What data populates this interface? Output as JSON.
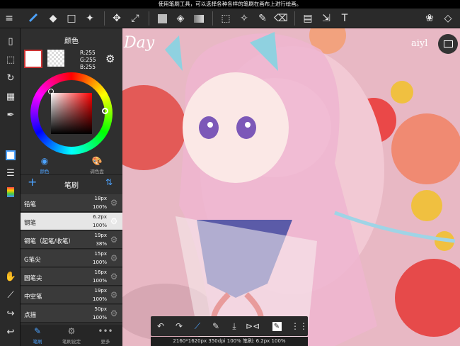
{
  "status": {
    "message": "使用笔刷工具，可以选择各种各样的笔刷在画布上进行绘画。"
  },
  "toolbar": {
    "icons": [
      "menu-icon",
      "brush-tool-icon",
      "eraser-tool-icon",
      "shape-tool-icon",
      "magic-wand-icon",
      "move-icon",
      "transform-icon",
      "fill-color-icon",
      "bucket-icon",
      "gradient-icon",
      "select-rect-icon",
      "auto-select-icon",
      "select-pen-icon",
      "select-eraser-icon",
      "panel-layout-icon",
      "hand-select-icon",
      "text-tool-icon",
      "material-icon",
      "layers-icon"
    ]
  },
  "color_panel": {
    "title": "颜色",
    "r": "R:255",
    "g": "G:255",
    "b": "B:255",
    "tab_color": "颜色",
    "tab_palette": "调色盘"
  },
  "brush_panel": {
    "title": "笔刷",
    "items": [
      {
        "name": "铅笔",
        "size": "18px",
        "opacity": "100%"
      },
      {
        "name": "钢笔",
        "size": "6.2px",
        "opacity": "100%"
      },
      {
        "name": "钢笔（起笔/收笔）",
        "size": "19px",
        "opacity": "38%"
      },
      {
        "name": "G笔尖",
        "size": "15px",
        "opacity": "100%"
      },
      {
        "name": "圆笔尖",
        "size": "16px",
        "opacity": "100%"
      },
      {
        "name": "中空笔",
        "size": "19px",
        "opacity": "100%"
      },
      {
        "name": "点描",
        "size": "50px",
        "opacity": "100%"
      }
    ],
    "selected_index": 1
  },
  "bottom_tabs": {
    "brush": "笔刷",
    "brush_settings": "笔刷设定",
    "more": "更多"
  },
  "canvas": {
    "text_left": "Day",
    "text_right": "aiyl"
  },
  "info_bar": {
    "text": "2160*1620px 350dpi 100% 笔刷: 6.2px 100%"
  },
  "colors": {
    "accent": "#4da3ff",
    "panel": "#2f2f2f"
  }
}
